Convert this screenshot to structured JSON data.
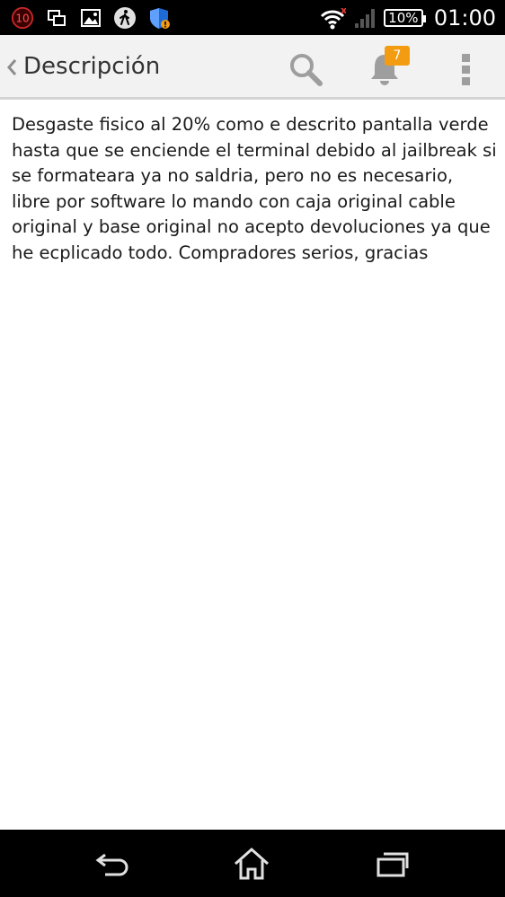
{
  "status_bar": {
    "notification_count": "10",
    "battery_percent": "10%",
    "time": "01:00",
    "icons": [
      "notification-counter-icon",
      "screen-mirror-icon",
      "image-icon",
      "walking-person-icon",
      "shield-warning-icon",
      "wifi-icon",
      "signal-icon",
      "battery-icon"
    ]
  },
  "action_bar": {
    "title": "Descripción",
    "notification_badge": "7",
    "icons": [
      "back-chevron-icon",
      "search-icon",
      "bell-icon",
      "overflow-menu-icon"
    ],
    "colors": {
      "background": "#f2f2f2",
      "badge": "#f39c12"
    }
  },
  "description": {
    "text": "Desgaste fisico al 20% como e descrito pantalla verde hasta que se enciende el terminal debido al jailbreak si se formateara ya no saldria, pero no es necesario, libre por software lo mando con caja original cable original y base original no acepto devoluciones ya que he ecplicado todo. Compradores serios, gracias"
  },
  "nav_bar": {
    "icons": [
      "back-arrow-icon",
      "home-icon",
      "recent-apps-icon"
    ]
  }
}
